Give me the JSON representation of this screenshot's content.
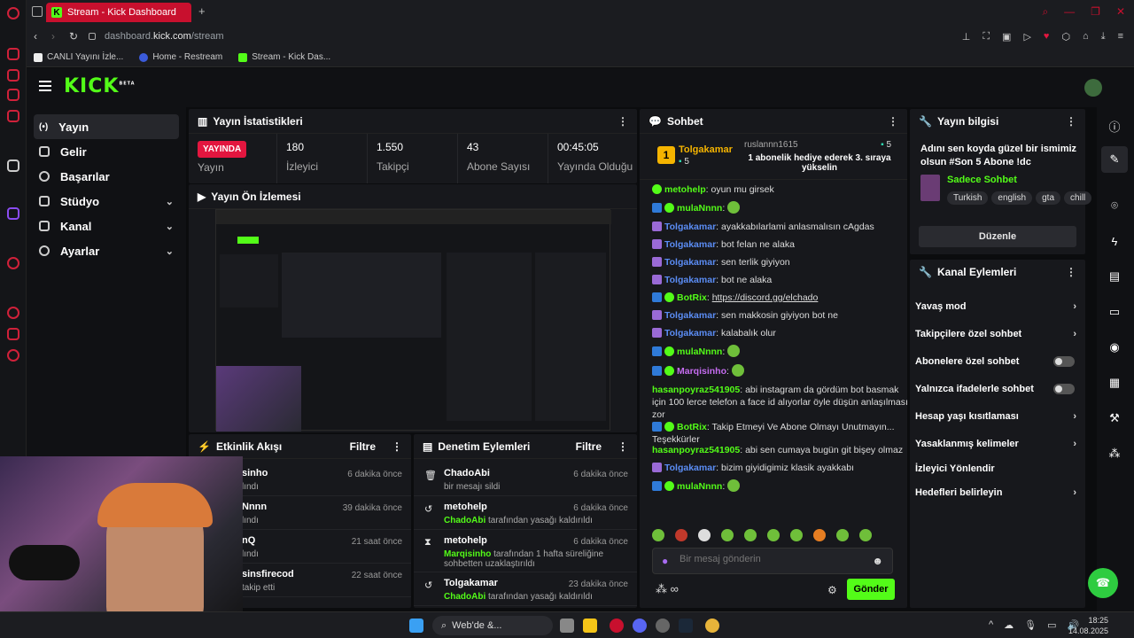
{
  "browser": {
    "tab_title": "Stream - Kick Dashboard",
    "new_tab": "+",
    "url_prefix": "dashboard.",
    "url_domain": "kick.com",
    "url_path": "/stream",
    "bookmarks": [
      {
        "label": "CANLI Yayını İzle..."
      },
      {
        "label": "Home - Restream"
      },
      {
        "label": "Stream - Kick Das..."
      }
    ]
  },
  "header": {
    "logo": "KICK",
    "logo_badge": "BETA"
  },
  "sidebar": {
    "items": [
      {
        "label": "Yayın",
        "icon": "broadcast-icon"
      },
      {
        "label": "Gelir",
        "icon": "wallet-icon"
      },
      {
        "label": "Başarılar",
        "icon": "trophy-icon"
      },
      {
        "label": "Stüdyo",
        "icon": "camera-icon"
      },
      {
        "label": "Kanal",
        "icon": "user-icon"
      },
      {
        "label": "Ayarlar",
        "icon": "gear-icon"
      }
    ]
  },
  "stats": {
    "title": "Yayın İstatistikleri",
    "live_label": "YAYINDA",
    "live_sub": "Yayın",
    "viewers": "180",
    "viewers_label": "İzleyici",
    "followers": "1.550",
    "followers_label": "Takipçi",
    "subs": "43",
    "subs_label": "Abone Sayısı",
    "uptime": "00:45:05",
    "uptime_label": "Yayında Olduğu"
  },
  "preview": {
    "title": "Yayın Ön İzlemesi"
  },
  "activity": {
    "title": "Etkinlik Akışı",
    "filter": "Filtre",
    "items": [
      {
        "name": "sinho",
        "time": "6 dakika önce",
        "sub": "lındı"
      },
      {
        "name": "Nnnn",
        "time": "39 dakika önce",
        "sub": "lındı"
      },
      {
        "name": "nQ",
        "time": "21 saat önce",
        "sub": "lındı"
      },
      {
        "name": "sinsfirecod",
        "time": "22 saat önce",
        "sub": "takip etti"
      }
    ]
  },
  "moderation": {
    "title": "Denetim Eylemleri",
    "filter": "Filtre",
    "items": [
      {
        "name": "ChadoAbi",
        "time": "6 dakika önce",
        "who": "",
        "sub": "bir mesajı sildi"
      },
      {
        "name": "metohelp",
        "time": "6 dakika önce",
        "who": "ChadoAbi",
        "sub": "tarafından yasağı kaldırıldı"
      },
      {
        "name": "metohelp",
        "time": "6 dakika önce",
        "who": "Marqisinho",
        "sub": "tarafından 1 hafta süreliğine sohbetten uzaklaştırıldı"
      },
      {
        "name": "Tolgakamar",
        "time": "23 dakika önce",
        "who": "ChadoAbi",
        "sub": "tarafından yasağı kaldırıldı"
      }
    ]
  },
  "chat": {
    "title": "Sohbet",
    "pinned_rank": "1",
    "pinned_user": "Tolgakamar",
    "pinned_count": "5",
    "gifter": "ruslannn1615",
    "gift_count": "5",
    "gift_text": "1 abonelik hediye ederek 3. sıraya yükselin",
    "messages": [
      {
        "user": "metohelp",
        "color": "#53fc18",
        "text": "oyun mu girsek",
        "badges": [
          "green"
        ]
      },
      {
        "user": "mulaNnnn",
        "color": "#53fc18",
        "text": "",
        "badges": [
          "blue",
          "green"
        ]
      },
      {
        "user": "Tolgakamar",
        "color": "#5b8df5",
        "text": "ayakkabılarlami anlasmalısın cAgdas",
        "badges": [
          "purple"
        ]
      },
      {
        "user": "Tolgakamar",
        "color": "#5b8df5",
        "text": "bot felan ne alaka",
        "badges": [
          "purple"
        ]
      },
      {
        "user": "Tolgakamar",
        "color": "#5b8df5",
        "text": "sen terlik giyiyon",
        "badges": [
          "purple"
        ]
      },
      {
        "user": "Tolgakamar",
        "color": "#5b8df5",
        "text": "bot ne alaka",
        "badges": [
          "purple"
        ]
      },
      {
        "user": "BotRix",
        "color": "#53fc18",
        "text": "https://discord.gg/elchado",
        "badges": [
          "blue",
          "green"
        ]
      },
      {
        "user": "Tolgakamar",
        "color": "#5b8df5",
        "text": "sen makkosin giyiyon bot ne",
        "badges": [
          "purple"
        ]
      },
      {
        "user": "Tolgakamar",
        "color": "#5b8df5",
        "text": "kalabalık olur",
        "badges": [
          "purple"
        ]
      },
      {
        "user": "mulaNnnn",
        "color": "#53fc18",
        "text": "",
        "badges": [
          "blue",
          "green"
        ]
      },
      {
        "user": "Marqisinho",
        "color": "#c56cf0",
        "text": "",
        "badges": [
          "blue",
          "green"
        ]
      },
      {
        "user": "hasanpoyraz541905",
        "color": "#53fc18",
        "text": "abi instagram da gördüm bot basmak için 100 lerce telefon a face id alıyorlar öyle düşün anlaşılması zor",
        "badges": []
      },
      {
        "user": "BotRix",
        "color": "#53fc18",
        "text": "Takip Etmeyi Ve Abone Olmayı Unutmayın... Teşekkürler",
        "badges": [
          "blue",
          "green"
        ]
      },
      {
        "user": "hasanpoyraz541905",
        "color": "#53fc18",
        "text": "abi sen cumaya bugün git bişey olmaz",
        "badges": []
      },
      {
        "user": "Tolgakamar",
        "color": "#5b8df5",
        "text": "bizim giyidigimiz klasik ayakkabı",
        "badges": [
          "purple"
        ]
      },
      {
        "user": "mulaNnnn",
        "color": "#53fc18",
        "text": "",
        "badges": [
          "blue",
          "green"
        ]
      }
    ],
    "input_placeholder": "Bir mesaj gönderin",
    "send": "Gönder"
  },
  "stream_info": {
    "title": "Yayın bilgisi",
    "stream_title": "Adını sen koyda güzel bir ismimiz olsun #Son 5 Abone !dc",
    "category": "Sadece Sohbet",
    "tags": [
      "Turkish",
      "english",
      "gta",
      "chill"
    ],
    "edit": "Düzenle"
  },
  "channel_actions": {
    "title": "Kanal Eylemleri",
    "items": [
      {
        "label": "Yavaş mod",
        "kind": "chevron"
      },
      {
        "label": "Takipçilere özel sohbet",
        "kind": "chevron"
      },
      {
        "label": "Abonelere özel sohbet",
        "kind": "toggle"
      },
      {
        "label": "Yalnızca ifadelerle sohbet",
        "kind": "toggle"
      },
      {
        "label": "Hesap yaşı kısıtlaması",
        "kind": "chevron"
      },
      {
        "label": "Yasaklanmış kelimeler",
        "kind": "chevron"
      },
      {
        "label": "İzleyici Yönlendir",
        "kind": "none"
      },
      {
        "label": "Hedefleri belirleyin",
        "kind": "chevron"
      }
    ]
  },
  "taskbar": {
    "search": "Web'de &...",
    "time": "18:25",
    "date": "14.08.2025"
  },
  "colors": {
    "kick_green": "#53fc18",
    "opera_red": "#c8102e",
    "live_red": "#e3163f"
  }
}
